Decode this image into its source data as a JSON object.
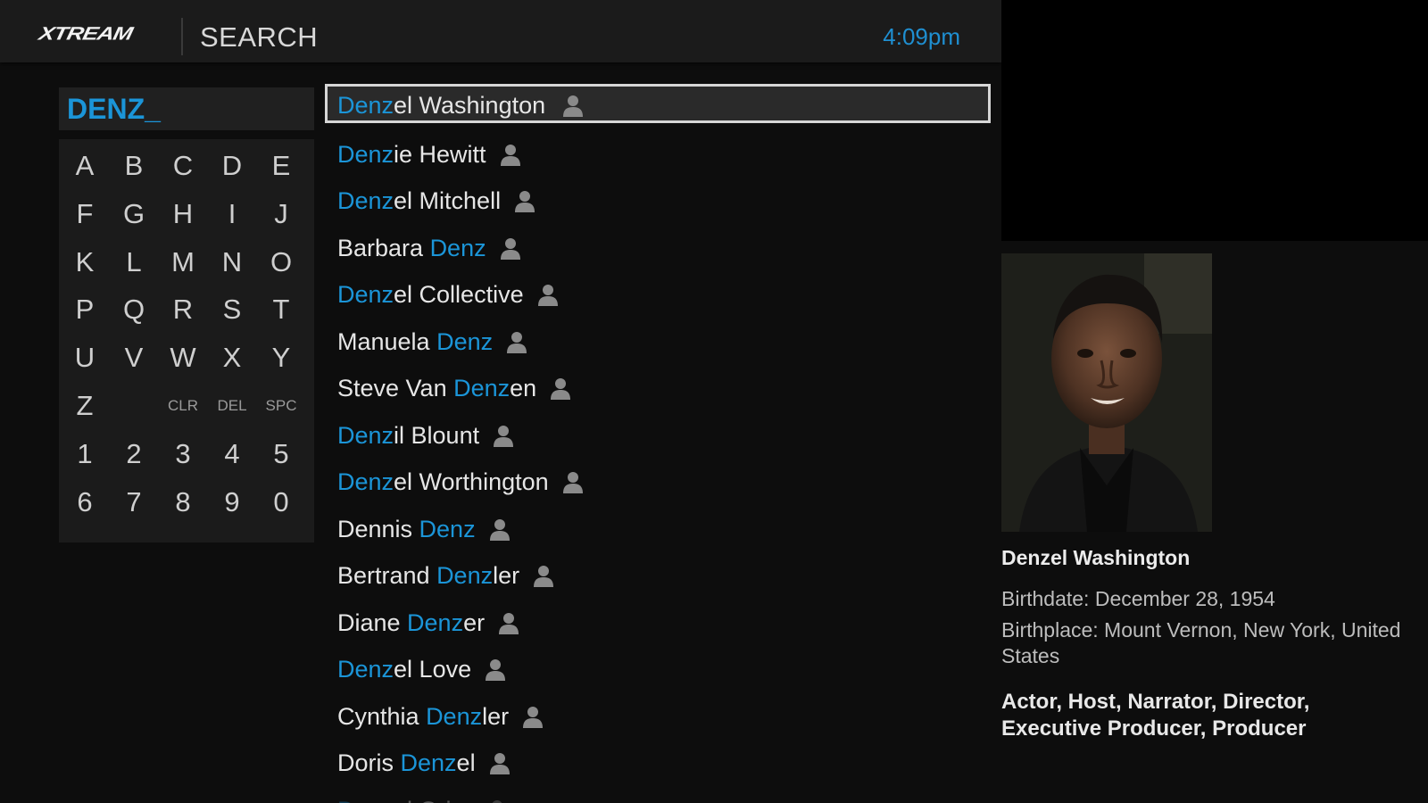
{
  "header": {
    "logo": "Xtream",
    "title": "SEARCH",
    "clock": "4:09pm"
  },
  "search": {
    "query": "DENZ_"
  },
  "keyboard": {
    "rows": [
      [
        "A",
        "B",
        "C",
        "D",
        "E"
      ],
      [
        "F",
        "G",
        "H",
        "I",
        "J"
      ],
      [
        "K",
        "L",
        "M",
        "N",
        "O"
      ],
      [
        "P",
        "Q",
        "R",
        "S",
        "T"
      ],
      [
        "U",
        "V",
        "W",
        "X",
        "Y"
      ],
      [
        "Z",
        "",
        "CLR",
        "DEL",
        "SPC"
      ],
      [
        "1",
        "2",
        "3",
        "4",
        "5"
      ],
      [
        "6",
        "7",
        "8",
        "9",
        "0"
      ]
    ]
  },
  "results": [
    {
      "pre": "",
      "hl": "Denz",
      "post": "el Washington",
      "selected": true
    },
    {
      "pre": "",
      "hl": "Denz",
      "post": "ie Hewitt"
    },
    {
      "pre": "",
      "hl": "Denz",
      "post": "el Mitchell"
    },
    {
      "pre": "Barbara ",
      "hl": "Denz",
      "post": ""
    },
    {
      "pre": "",
      "hl": "Denz",
      "post": "el Collective"
    },
    {
      "pre": "Manuela ",
      "hl": "Denz",
      "post": ""
    },
    {
      "pre": "Steve Van ",
      "hl": "Denz",
      "post": "en"
    },
    {
      "pre": "",
      "hl": "Denz",
      "post": "il Blount"
    },
    {
      "pre": "",
      "hl": "Denz",
      "post": "el Worthington"
    },
    {
      "pre": "Dennis ",
      "hl": "Denz",
      "post": ""
    },
    {
      "pre": "Bertrand ",
      "hl": "Denz",
      "post": "ler"
    },
    {
      "pre": "Diane ",
      "hl": "Denz",
      "post": "er"
    },
    {
      "pre": "",
      "hl": "Denz",
      "post": "el Love"
    },
    {
      "pre": "Cynthia ",
      "hl": "Denz",
      "post": "ler"
    },
    {
      "pre": "Doris ",
      "hl": "Denz",
      "post": "el"
    },
    {
      "pre": "",
      "hl": "Denz",
      "post": "el Grier",
      "fade": true
    }
  ],
  "detail": {
    "name": "Denzel Washington",
    "birthdate": "Birthdate: December 28, 1954",
    "birthplace": "Birthplace: Mount Vernon, New York, United States",
    "roles": "Actor, Host, Narrator, Director, Executive Producer, Producer"
  },
  "colors": {
    "accent": "#1b95d8",
    "header_bg": "#1b1b1b",
    "panel_bg": "#1b1b1b",
    "page_bg": "#0d0d0d"
  },
  "icons": {
    "result_type": "person-icon"
  }
}
